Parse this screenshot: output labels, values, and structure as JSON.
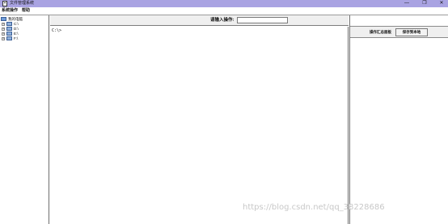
{
  "window": {
    "title": "文件管理系统",
    "minimize_glyph": "—",
    "restore_glyph": "❐",
    "close_glyph": "✕"
  },
  "menu": {
    "items": [
      "系统操作",
      "帮助"
    ]
  },
  "tree": {
    "root_label": "我的电脑",
    "drives": [
      {
        "expander": "+",
        "label": "C:\\"
      },
      {
        "expander": "+",
        "label": "D:\\"
      },
      {
        "expander": "+",
        "label": "E:\\"
      },
      {
        "expander": "+",
        "label": "F:\\"
      }
    ]
  },
  "command": {
    "label": "请输入操作:",
    "value": ""
  },
  "console": {
    "text": "C:\\>"
  },
  "summary": {
    "label": "操作汇总面板",
    "save_button": "保存到本地"
  },
  "watermark": {
    "text": "https://blog.csdn.net/qq_38228686"
  },
  "colors": {
    "titlebar": "#a9a3e2",
    "panel_header": "#efefef",
    "border": "#6f6f6f"
  }
}
